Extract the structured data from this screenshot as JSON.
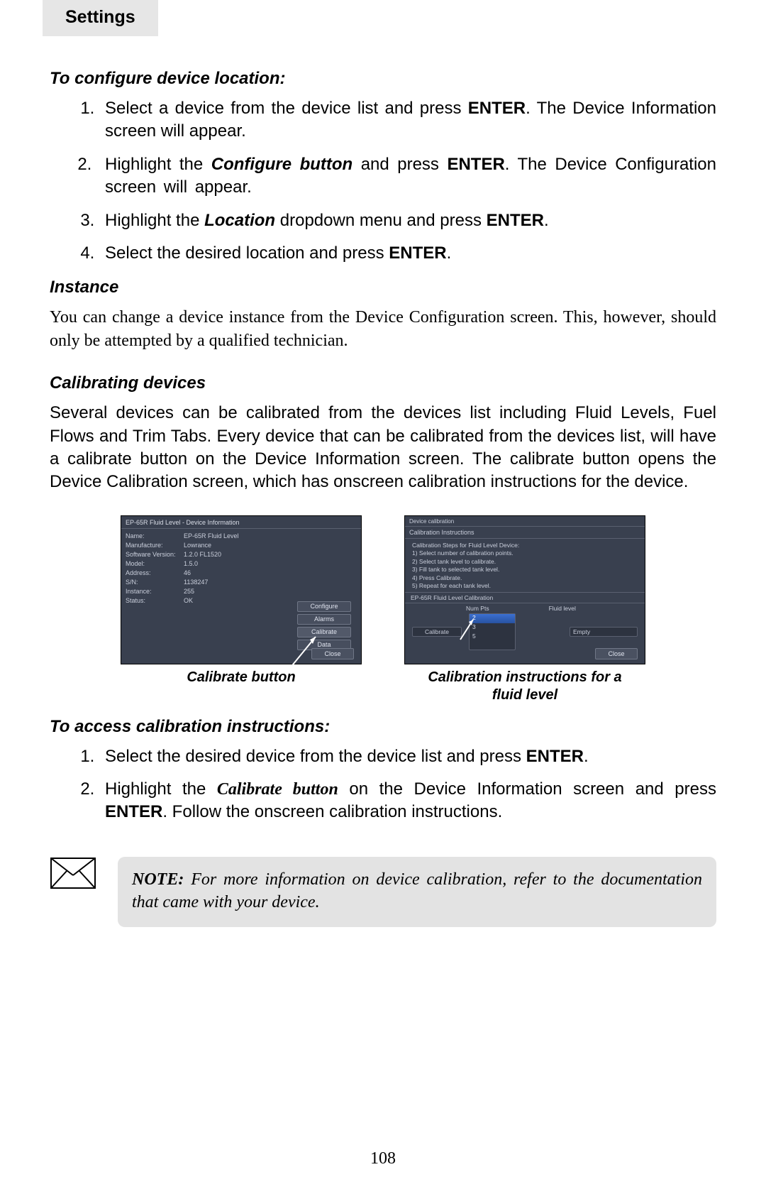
{
  "header": {
    "tab": "Settings"
  },
  "s1": {
    "heading": "To configure device location:",
    "step1a": "Select a device from the device list and press ",
    "step1b": "ENTER",
    "step1c": ". The Device Information screen will appear.",
    "step2a": "Highlight the ",
    "step2b": "Configure button",
    "step2c": " and press ",
    "step2d": "ENTER",
    "step2e": ". The Device Configuration screen will appear.",
    "step3a": "Highlight the ",
    "step3b": "Location",
    "step3c": " dropdown menu and press ",
    "step3d": "ENTER",
    "step3e": ".",
    "step4a": "Select the desired location and press ",
    "step4b": "ENTER",
    "step4c": "."
  },
  "s2": {
    "heading": "Instance",
    "para": "You can change a device instance from the Device Configuration screen. This, however, should only be attempted by a qualified technician."
  },
  "s3": {
    "heading": "Calibrating devices",
    "para": "Several devices can be calibrated from the devices list including Fluid Levels, Fuel Flows and Trim Tabs. Every device that can be calibrated from the devices list, will have a calibrate button on the Device Information screen. The calibrate button opens the Device Calibration screen, which has onscreen calibration instructions for the device."
  },
  "panel1": {
    "title": "EP-65R Fluid Level - Device Information",
    "rows": {
      "name_k": "Name:",
      "name_v": "EP-65R Fluid Level",
      "manu_k": "Manufacture:",
      "manu_v": "Lowrance",
      "soft_k": "Software Version:",
      "soft_v": "1.2.0 FL1520",
      "model_k": "Model:",
      "model_v": "1.5.0",
      "addr_k": "Address:",
      "addr_v": "46",
      "sn_k": "S/N:",
      "sn_v": "1138247",
      "inst_k": "Instance:",
      "inst_v": "255",
      "stat_k": "Status:",
      "stat_v": "OK"
    },
    "buttons": {
      "configure": "Configure",
      "alarms": "Alarms",
      "calibrate": "Calibrate",
      "data": "Data",
      "close": "Close"
    },
    "caption": "Calibrate button"
  },
  "panel2": {
    "title": "Device calibration",
    "sub": "Calibration Instructions",
    "instr_head": "Calibration Steps for Fluid Level Device:",
    "instr1": "1) Select number of calibration points.",
    "instr2": "2) Select tank level to calibrate.",
    "instr3": "3) Fill tank to selected tank level.",
    "instr4": "4) Press Calibrate.",
    "instr5": "5) Repeat for each tank level.",
    "section": "EP-65R Fluid Level Calibration",
    "calibrate_btn": "Calibrate",
    "col_numpts": "Num Pts",
    "col_fluid": "Fluid level",
    "opt2": "2",
    "opt3": "3",
    "opt5": "5",
    "fluid_val": "Empty",
    "close": "Close",
    "caption": "Calibration instructions for a fluid level"
  },
  "s4": {
    "heading": "To access calibration instructions:",
    "step1a": "Select the desired device from the device list and press ",
    "step1b": "ENTER",
    "step1c": ".",
    "step2a": "Highlight the ",
    "step2b": "Calibrate button",
    "step2c": " on the Device Information screen and press ",
    "step2d": "ENTER",
    "step2e": ". Follow the onscreen calibration instructions."
  },
  "note": {
    "label": "NOTE: ",
    "text": "For more information on device calibration, refer to the documentation that came with your device."
  },
  "page_number": "108"
}
